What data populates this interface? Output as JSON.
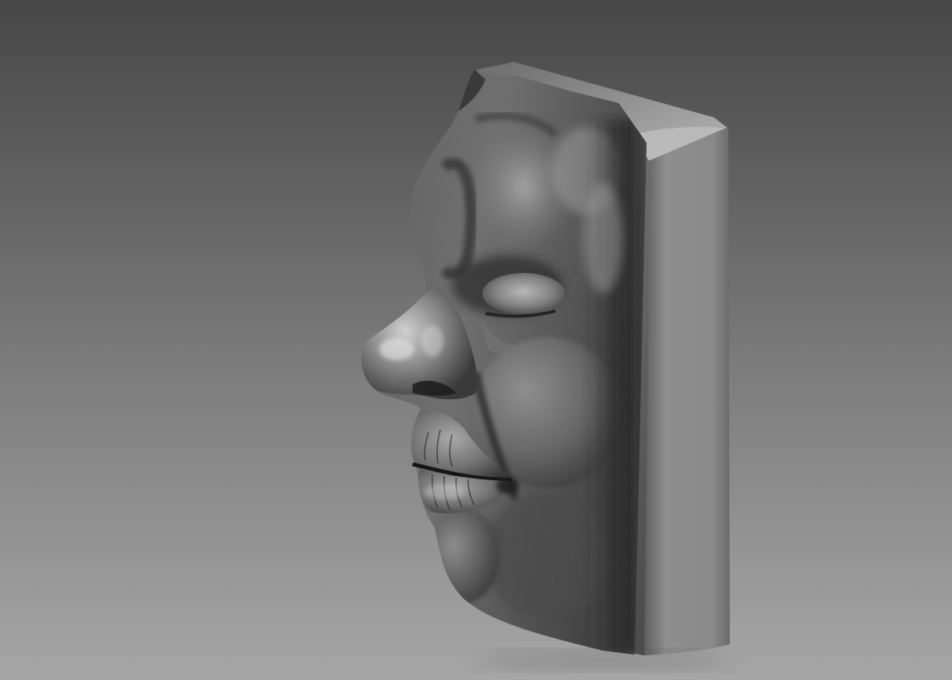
{
  "scene": {
    "subject": "sculpted-face-relief-block",
    "render_style": "grayscale-clay-render",
    "colors": {
      "background_top": "#4a4a4a",
      "background_bottom": "#a5a5a5",
      "clay_light": "#b4b4b4",
      "clay_mid": "#6e6e6e",
      "clay_dark": "#262626",
      "block_side": "#8a8a8a"
    }
  }
}
